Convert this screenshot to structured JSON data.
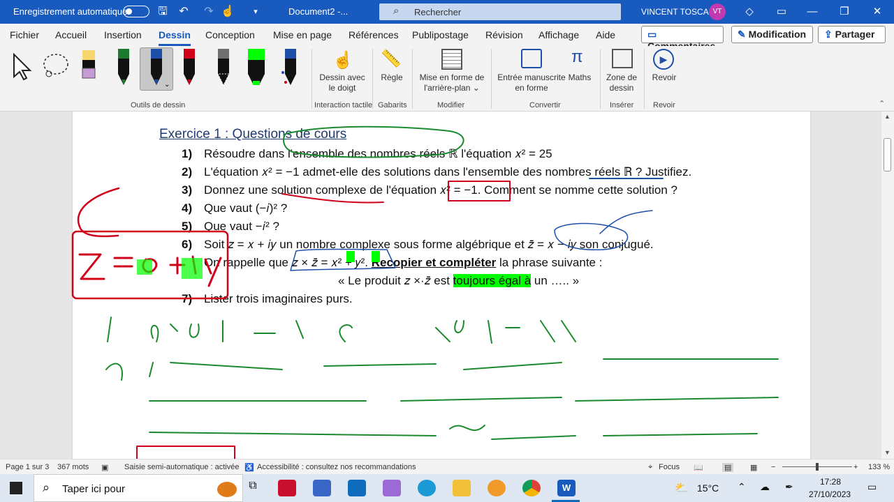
{
  "titlebar": {
    "autosave_label": "Enregistrement automatique",
    "doc_title": "Document2  -...",
    "search_placeholder": "Rechercher",
    "user_name": "VINCENT TOSCA",
    "user_initials": "VT"
  },
  "menu": {
    "tabs": [
      "Fichier",
      "Accueil",
      "Insertion",
      "Dessin",
      "Conception",
      "Mise en page",
      "Références",
      "Publipostage",
      "Révision",
      "Affichage",
      "Aide"
    ],
    "active_tab": "Dessin",
    "comments": "Commentaires",
    "editing": "Modification",
    "share": "Partager"
  },
  "ribbon": {
    "group_drawing_tools": "Outils de dessin",
    "draw_with_finger": [
      "Dessin avec",
      "le doigt"
    ],
    "ruler": "Règle",
    "format_bg": [
      "Mise en forme de",
      "l'arrière-plan"
    ],
    "ink_to_shape": [
      "Entrée manuscrite",
      "en forme"
    ],
    "math": "Maths",
    "drawing_canvas": [
      "Zone de",
      "dessin"
    ],
    "replay": "Revoir",
    "group_touch": "Interaction tactile",
    "group_stencils": "Gabarits",
    "group_modify": "Modifier",
    "group_convert": "Convertir",
    "group_insert": "Insérer",
    "group_replay": "Revoir",
    "pen_colors": [
      "#1e1e1e",
      "#1b7a2e",
      "#1e4fa8",
      "#d0021b",
      "#707070",
      "#00ff00",
      "#1e4fa8"
    ]
  },
  "document": {
    "heading": "Exercice 1 : Questions de cours",
    "items": [
      {
        "n": "1)",
        "text": "Résoudre dans l'ensemble des nombres réels ℝ l'équation  𝑥² = 25"
      },
      {
        "n": "2)",
        "text": "L'équation 𝑥² = −1  admet-elle des solutions dans l'ensemble des nombres réels ℝ ? Justifiez."
      },
      {
        "n": "3)",
        "text": "Donnez une solution complexe de l'équation 𝑥² = −1. Comment se nomme cette solution ?"
      },
      {
        "n": "4)",
        "text": "Que vaut (−𝑖)² ?"
      },
      {
        "n": "5)",
        "text": "Que vaut −𝑖² ?"
      },
      {
        "n": "6)",
        "text": "Soit 𝑧 = 𝑥 + 𝑖𝑦  un nombre complexe sous forme algébrique et 𝑧̄ = 𝑥 − 𝑖𝑦 son conjugué."
      }
    ],
    "item6b_pre": "On rappelle que ",
    "item6b_formula": "𝑧 × 𝑧̄ = 𝑥² + 𝑦²",
    "item6b_bold": "Recopier et compléter",
    "item6b_post": " la phrase suivante :",
    "quote_pre": "« Le produit 𝑧 ×·𝑧̄ est ",
    "quote_hl": "toujours égal à",
    "quote_post": " un ….. »",
    "item7_n": "7)",
    "item7_text": "Lister trois imaginaires purs."
  },
  "statusbar": {
    "page": "Page 1 sur 3",
    "words": "367 mots",
    "autocomplete": "Saisie semi-automatique : activée",
    "accessibility": "Accessibilité : consultez nos recommandations",
    "focus": "Focus",
    "zoom": "133 %"
  },
  "taskbar": {
    "search": "Taper ici pour",
    "weather": "15°C",
    "time": "17:28",
    "date": "27/10/2023"
  }
}
